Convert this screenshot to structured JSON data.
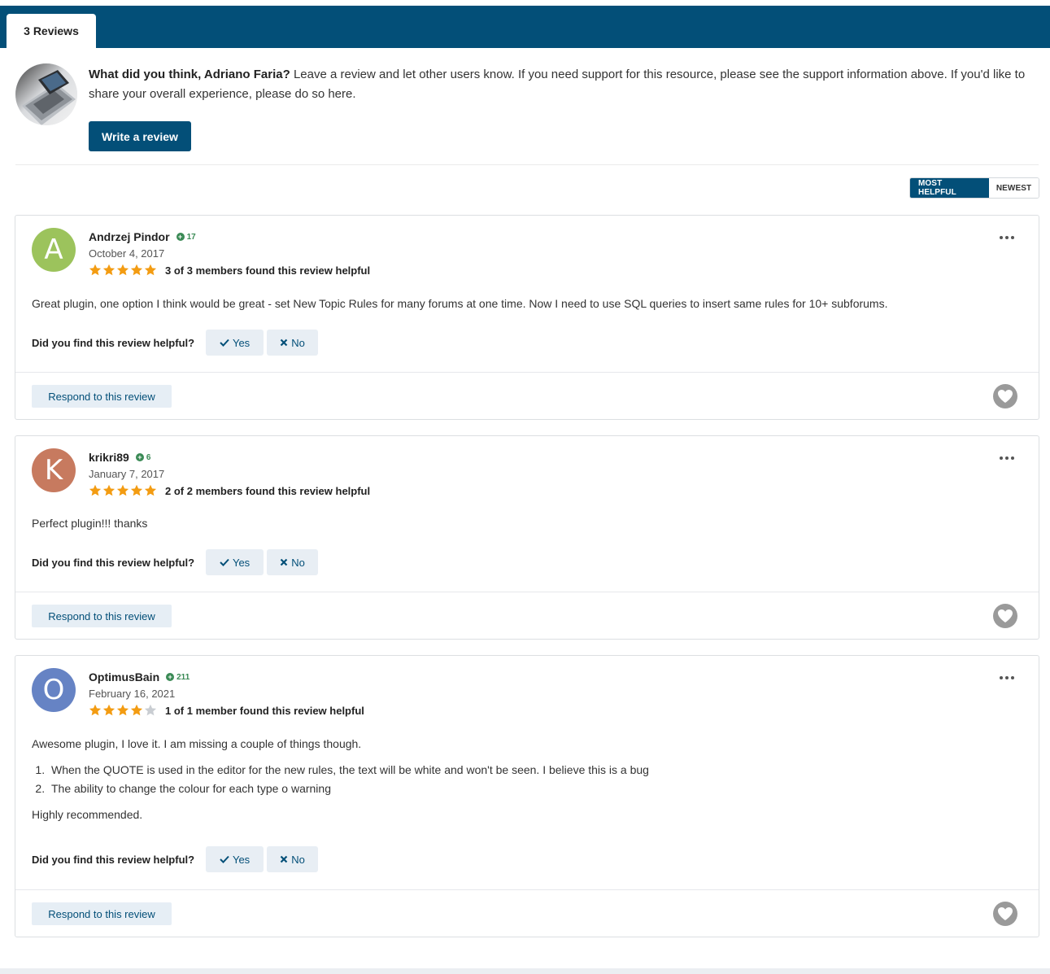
{
  "tab": {
    "label": "3 Reviews"
  },
  "intro": {
    "question": "What did you think, Adriano Faria?",
    "text": " Leave a review and let other users know. If you need support for this resource, please see the support information above. If you'd like to share your overall experience, please do so here.",
    "write_button": "Write a review"
  },
  "sort": {
    "active": "MOST HELPFUL",
    "inactive": "NEWEST"
  },
  "colors": {
    "brand": "#034f78",
    "star": "#f39c12",
    "star_empty": "#c9cdd2",
    "rep": "#3a8a55"
  },
  "ask_label": "Did you find this review helpful?",
  "yes_label": "Yes",
  "no_label": "No",
  "respond_label": "Respond to this review",
  "reviews": [
    {
      "initial": "A",
      "avatar_color": "#9cc35c",
      "author": "Andrzej Pindor",
      "reputation": "17",
      "date": "October 4, 2017",
      "rating": 5,
      "helpful": "3 of 3 members found this review helpful",
      "body": "Great plugin, one option I think would be great - set New Topic Rules for many forums at one time. Now I need to use SQL queries to insert same rules for 10+ subforums."
    },
    {
      "initial": "K",
      "avatar_color": "#c77a5f",
      "author": "krikri89",
      "reputation": "6",
      "date": "January 7, 2017",
      "rating": 5,
      "helpful": "2 of 2 members found this review helpful",
      "body": "Perfect plugin!!! thanks"
    },
    {
      "initial": "O",
      "avatar_color": "#6683c4",
      "author": "OptimusBain",
      "reputation": "211",
      "date": "February 16, 2021",
      "rating": 4,
      "helpful": "1 of 1 member found this review helpful",
      "body": "Awesome plugin, I love it. I am missing a couple of things though.",
      "list": [
        "When the QUOTE is used in the editor for the new rules, the text will be white and won't be seen. I believe this is a bug",
        "The ability to change the colour for each type o warning"
      ],
      "closing": "Highly recommended."
    }
  ]
}
